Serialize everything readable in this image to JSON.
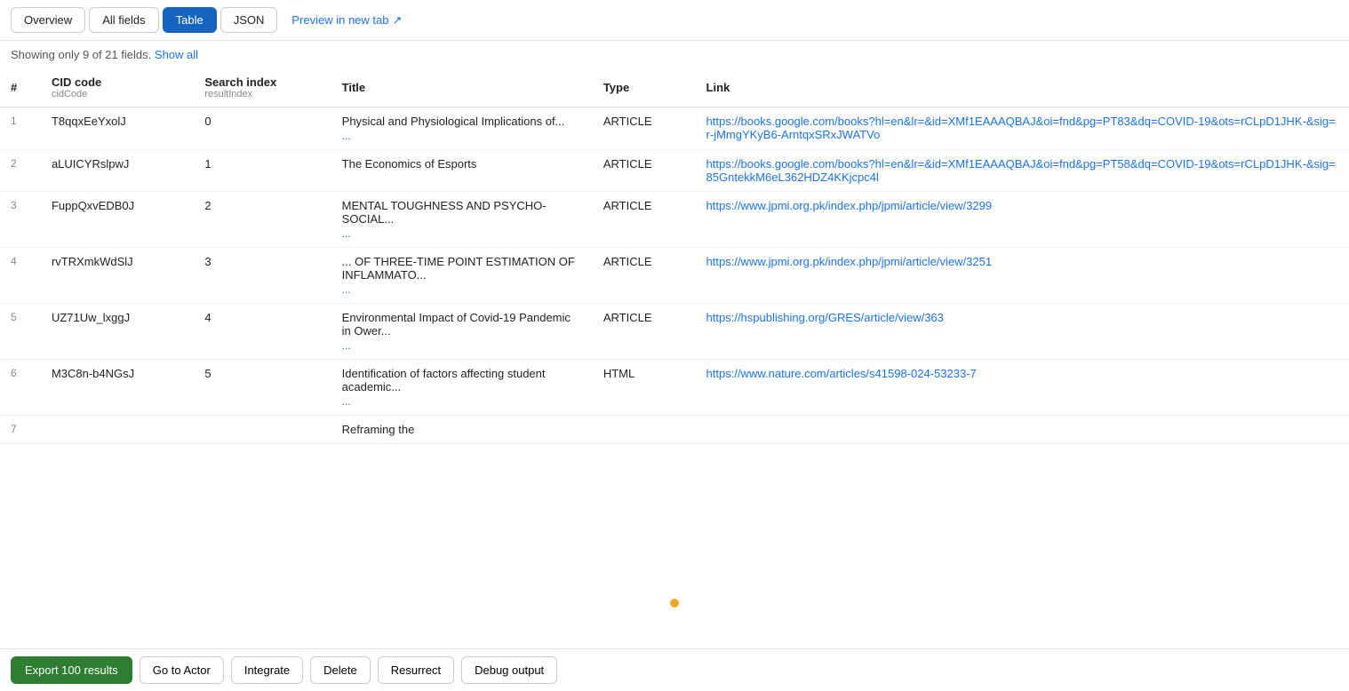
{
  "toolbar": {
    "overview_label": "Overview",
    "all_fields_label": "All fields",
    "table_label": "Table",
    "json_label": "JSON",
    "preview_label": "Preview in new tab",
    "active_tab": "table"
  },
  "fields_info": {
    "text": "Showing only 9 of 21 fields.",
    "show_all_label": "Show all"
  },
  "columns": [
    {
      "label": "#",
      "sub": ""
    },
    {
      "label": "CID code",
      "sub": "cidCode"
    },
    {
      "label": "Search index",
      "sub": "resultIndex"
    },
    {
      "label": "Title",
      "sub": ""
    },
    {
      "label": "Type",
      "sub": ""
    },
    {
      "label": "Link",
      "sub": ""
    }
  ],
  "rows": [
    {
      "num": 1,
      "cid": "T8qqxEeYxolJ",
      "index": "0",
      "title": "Physical and Physiological Implications of...",
      "title_has_more": true,
      "type": "ARTICLE",
      "link": "https://books.google.com/books?hl=en&lr=&id=XMf1EAAAQBAJ&oi=fnd&pg=PT83&dq=COVID-19&ots=rCLpD1JHK-&sig=r-jMmgYKyB6-ArntqxSRxJWATVo",
      "link_truncated": true
    },
    {
      "num": 2,
      "cid": "aLUICYRslpwJ",
      "index": "1",
      "title": "The Economics of Esports",
      "title_has_more": false,
      "type": "ARTICLE",
      "link": "https://books.google.com/books?hl=en&lr=&id=XMf1EAAAQBAJ&oi=fnd&pg=PT58&dq=COVID-19&ots=rCLpD1JHK-&sig=85GntekkM6eL362HDZ4KKjcpc4l",
      "link_truncated": true
    },
    {
      "num": 3,
      "cid": "FuppQxvEDB0J",
      "index": "2",
      "title": "MENTAL TOUGHNESS AND PSYCHO-SOCIAL...",
      "title_has_more": true,
      "type": "ARTICLE",
      "link": "https://www.jpmi.org.pk/index.php/jpmi/article/view/3299",
      "link_truncated": false
    },
    {
      "num": 4,
      "cid": "rvTRXmkWdSlJ",
      "index": "3",
      "title": "... OF THREE-TIME POINT ESTIMATION OF INFLAMMATO...",
      "title_has_more": true,
      "type": "ARTICLE",
      "link": "https://www.jpmi.org.pk/index.php/jpmi/article/view/3251",
      "link_truncated": false
    },
    {
      "num": 5,
      "cid": "UZ71Uw_lxggJ",
      "index": "4",
      "title": "Environmental Impact of Covid-19 Pandemic in Ower...",
      "title_has_more": true,
      "type": "ARTICLE",
      "link": "https://hspublishing.org/GRES/article/view/363",
      "link_truncated": false
    },
    {
      "num": 6,
      "cid": "M3C8n-b4NGsJ",
      "index": "5",
      "title": "Identification of factors affecting student academic...",
      "title_has_more": true,
      "type": "HTML",
      "link": "https://www.nature.com/articles/s41598-024-53233-7",
      "link_truncated": false
    },
    {
      "num": 7,
      "cid": "",
      "index": "",
      "title": "Reframing the",
      "title_has_more": false,
      "type": "",
      "link": "",
      "link_truncated": false
    }
  ],
  "bottom_bar": {
    "export_label": "Export 100 results",
    "go_to_actor_label": "Go to Actor",
    "integrate_label": "Integrate",
    "delete_label": "Delete",
    "resurrect_label": "Resurrect",
    "debug_label": "Debug output"
  }
}
